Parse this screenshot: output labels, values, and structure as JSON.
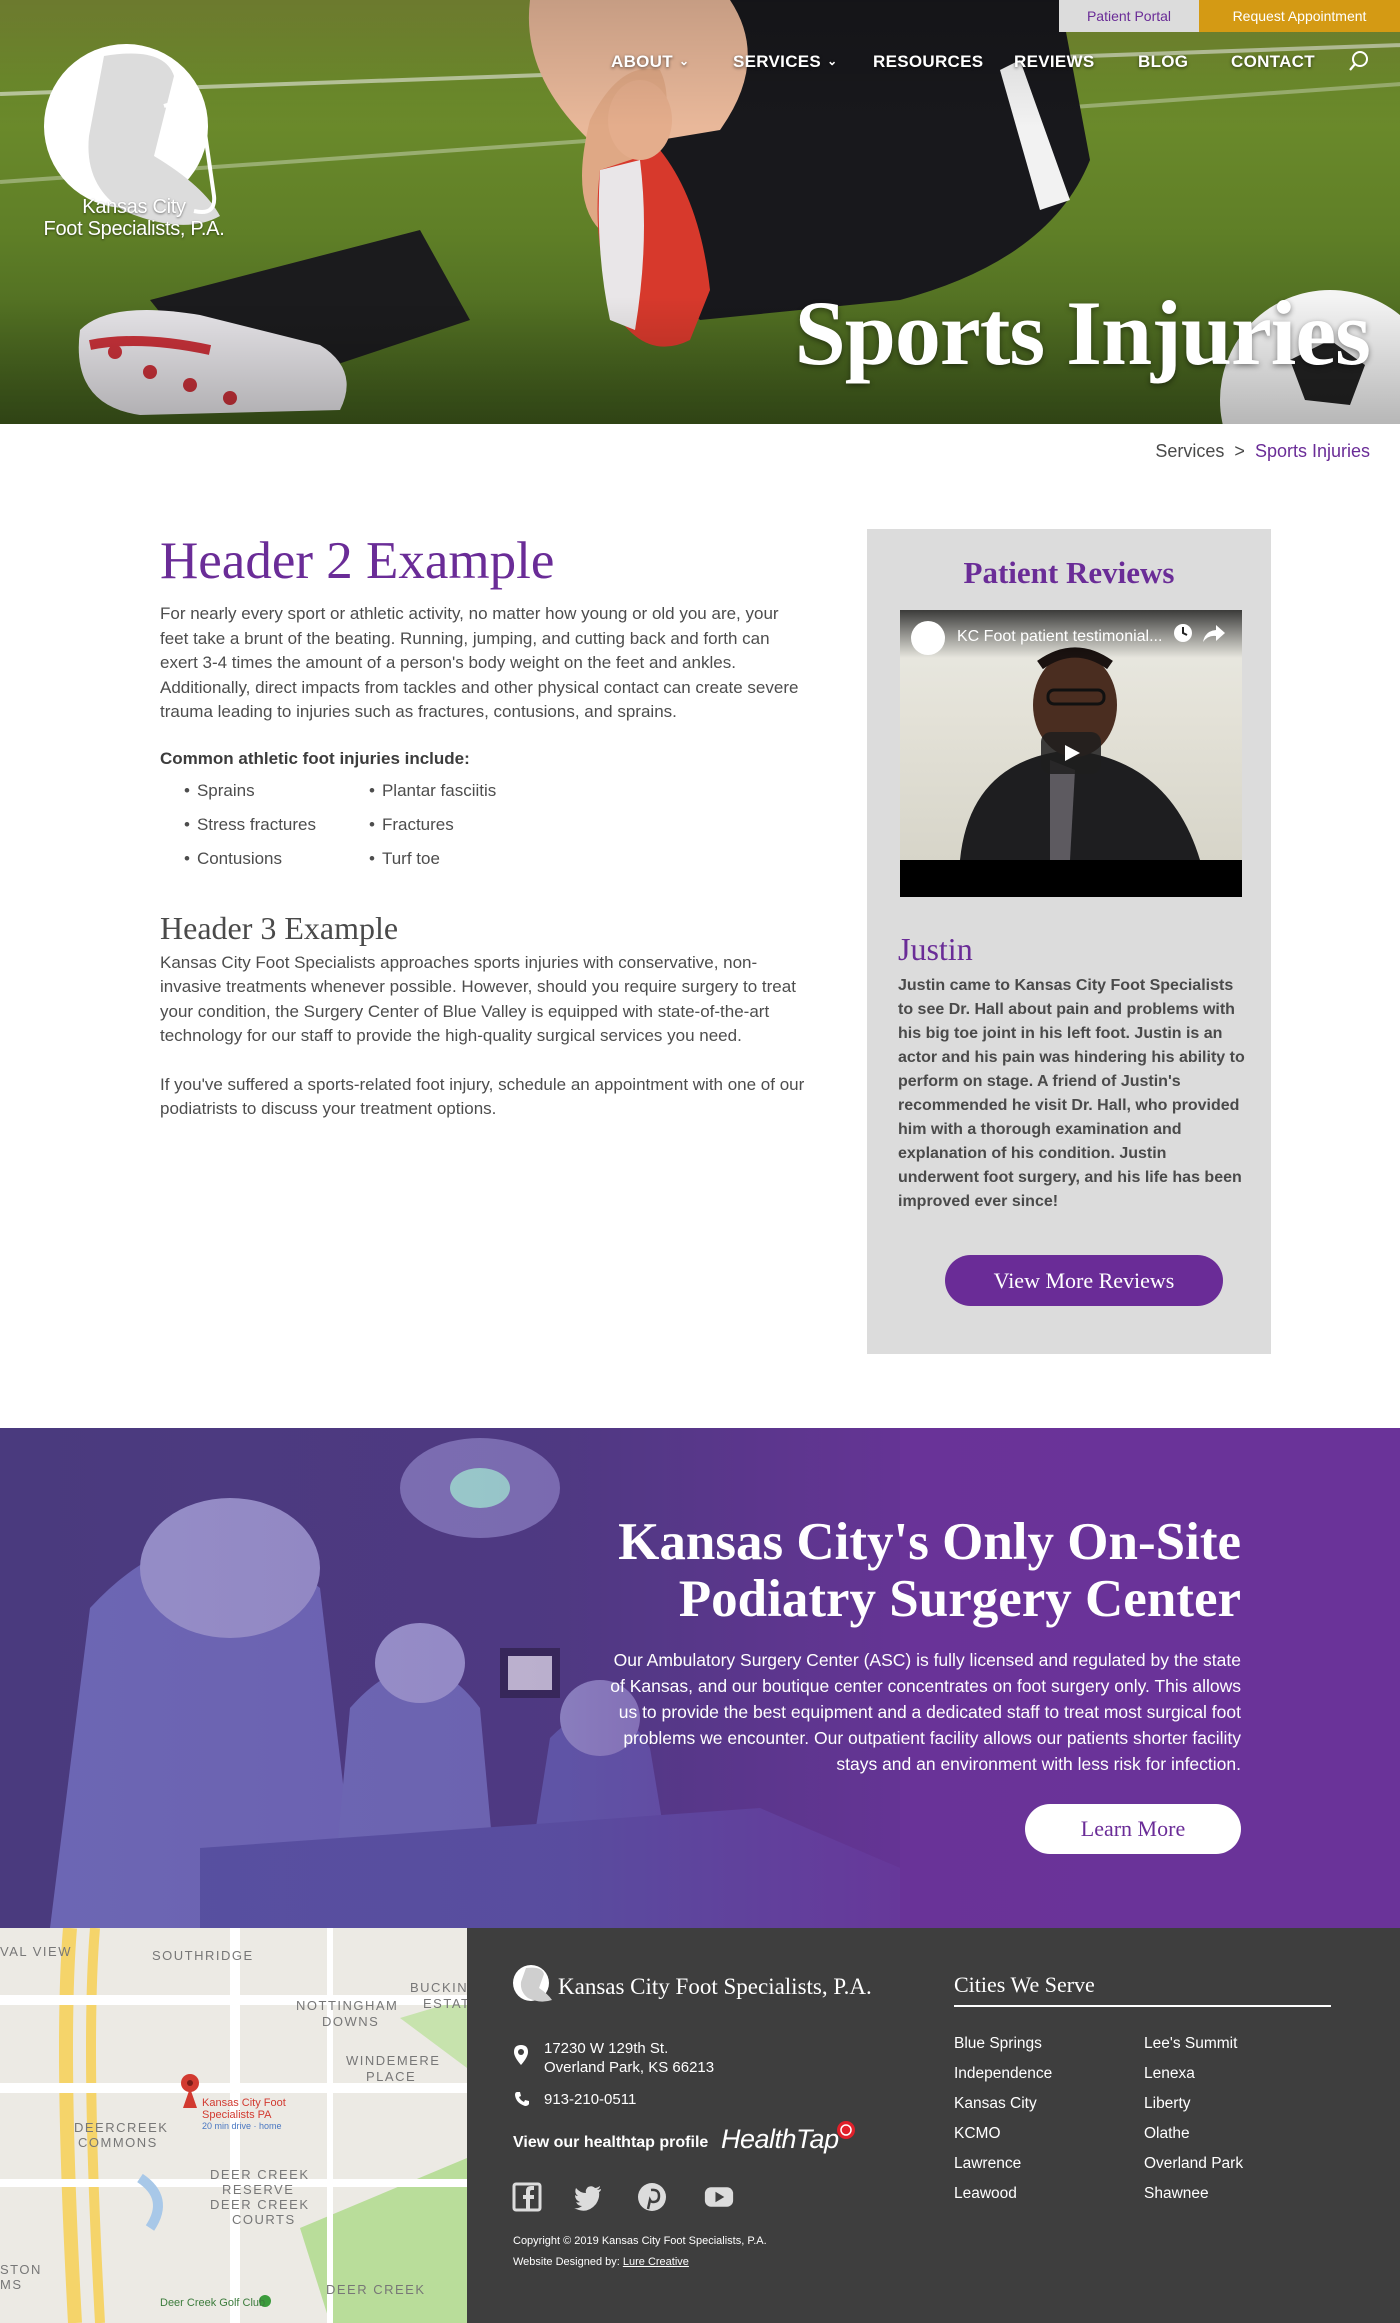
{
  "top_bar": {
    "patient_portal": "Patient Portal",
    "request_appointment": "Request Appointment"
  },
  "brand": {
    "logo_line1": "Kansas City",
    "logo_line2": "Foot Specialists, P.A."
  },
  "nav": {
    "items": [
      "ABOUT",
      "SERVICES",
      "RESOURCES",
      "REVIEWS",
      "BLOG",
      "CONTACT"
    ],
    "search_icon": "search-icon"
  },
  "hero": {
    "title": "Sports Injuries"
  },
  "breadcrumb": {
    "parent": "Services",
    "separator": ">",
    "current": "Sports Injuries"
  },
  "content": {
    "h2": "Header 2 Example",
    "intro": "For nearly every sport or athletic activity, no matter how young or old you are, your feet take a brunt of the beating. Running, jumping, and cutting back and forth can exert 3-4 times the amount of a person's body weight on the feet and ankles. Additionally, direct impacts from tackles and other physical contact can create severe trauma leading to injuries such as fractures, contusions, and sprains.",
    "list_heading": "Common athletic foot injuries include:",
    "injuries": [
      "Sprains",
      "Stress fractures",
      "Contusions",
      "Plantar fasciitis",
      "Fractures",
      "Turf toe"
    ],
    "h3": "Header 3 Example",
    "paragraph2": "Kansas City Foot Specialists approaches sports injuries with conservative, non-invasive treatments whenever possible. However, should you require surgery to treat your condition, the Surgery Center of Blue Valley is equipped with state-of-the-art technology for our staff to provide the high-quality surgical services you need.",
    "paragraph3": "If you've suffered a sports-related foot injury, schedule an appointment with one of our podiatrists to discuss your treatment options."
  },
  "reviews": {
    "title": "Patient Reviews",
    "video_title": "KC Foot patient testimonial...",
    "reviewer": "Justin",
    "text": "Justin came to Kansas City Foot Specialists to see Dr. Hall about pain and problems with his big toe joint in his left foot. Justin is an actor and his pain was hindering his ability to perform on stage. A friend of Justin's recommended he visit Dr. Hall, who provided him with a thorough examination and explanation of his condition. Justin underwent foot surgery, and his life has been improved ever since!",
    "button": "View More Reviews"
  },
  "banner": {
    "title_line1": "Kansas City's Only On-Site",
    "title_line2": "Podiatry Surgery Center",
    "body": "Our Ambulatory Surgery Center (ASC) is fully licensed and regulated by the state of Kansas, and our boutique center concentrates on foot surgery only. This allows us to provide the best equipment and a dedicated staff to treat most surgical foot problems we encounter. Our outpatient facility allows our patients shorter facility stays and an environment with less risk for infection.",
    "button": "Learn More"
  },
  "map": {
    "labels": [
      "VAL VIEW",
      "SOUTHRIDGE",
      "BUCKING",
      "ESTAT",
      "NOTTINGHAM",
      "DOWNS",
      "WINDEMERE",
      "PLACE",
      "DEERCREEK",
      "COMMONS",
      "DEER CREEK",
      "RESERVE",
      "DEER CREEK",
      "COURTS",
      "DEER CREEK",
      "STON",
      "MS"
    ],
    "pin_line1": "Kansas City Foot",
    "pin_line2": "Specialists PA",
    "pin_sub": "20 min drive · home",
    "golf": "Deer Creek Golf Club"
  },
  "footer": {
    "company": "Kansas City Foot Specialists, P.A.",
    "address_line1": "17230 W 129th St.",
    "address_line2": "Overland Park, KS 66213",
    "phone": "913-210-0511",
    "healthtap_label": "View our healthtap profile",
    "healthtap_logo": "HealthTap",
    "social": [
      "facebook-icon",
      "twitter-icon",
      "pinterest-icon",
      "youtube-icon"
    ],
    "copyright": "Copyright © 2019 Kansas City Foot Specialists, P.A.",
    "designed_by": "Website Designed by:",
    "designer": "Lure Creative",
    "cities_title": "Cities We Serve",
    "cities": [
      "Blue Springs",
      "Independence",
      "Kansas City",
      "KCMO",
      "Lawrence",
      "Leawood",
      "Lee's Summit",
      "Lenexa",
      "Liberty",
      "Olathe",
      "Overland Park",
      "Shawnee"
    ]
  },
  "colors": {
    "brand_purple": "#6a2c97",
    "appointment_gold": "#d49a14",
    "footer_dark": "#3e3e3e",
    "sidebar_gray": "#dcdcdc"
  }
}
